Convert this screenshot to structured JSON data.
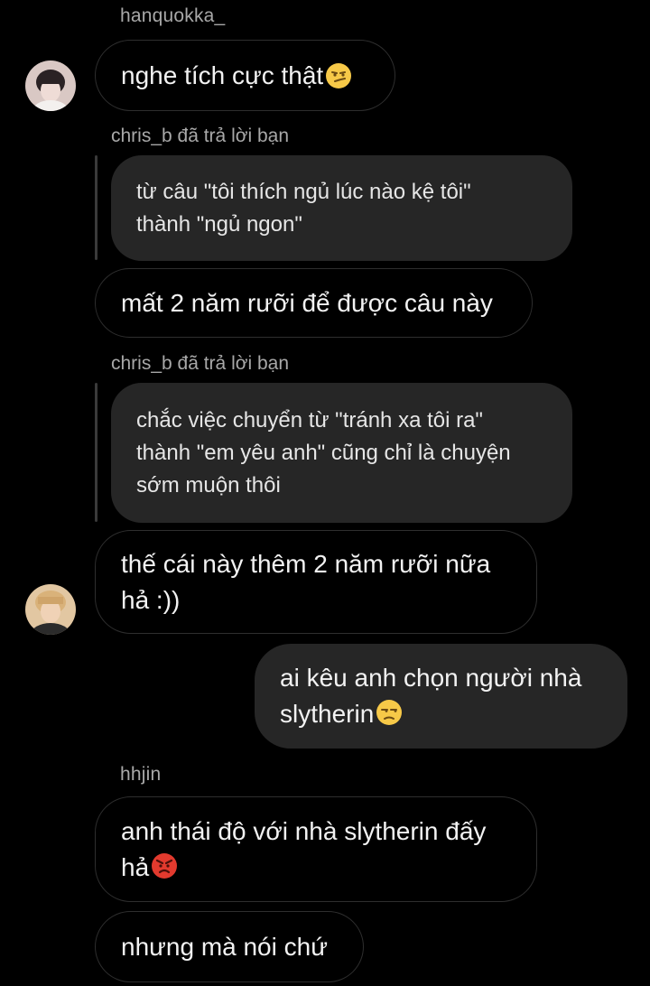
{
  "thread": {
    "group1": {
      "sender": "hanquokka_",
      "message": "nghe tích cực thật",
      "emoji": "smirk-emoji"
    },
    "reply1": {
      "caption": "chris_b đã trả lời bạn",
      "quoted_text": "từ câu \"tôi thích ngủ lúc nào kệ tôi\"\nthành \"ngủ ngon\"",
      "message": "mất 2 năm rưỡi để được câu này"
    },
    "reply2": {
      "caption": "chris_b đã trả lời bạn",
      "quoted_text": "chắc việc chuyển từ \"tránh xa tôi ra\"\nthành \"em yêu anh\" cũng chỉ là chuyện\nsớm muộn thôi",
      "message": "thế cái này thêm 2 năm rưỡi nữa\nhả :))"
    },
    "own_message": {
      "text": "ai kêu anh chọn người nhà\nslytherin",
      "emoji": "unamused-emoji"
    },
    "group2": {
      "sender": "hhjin",
      "message1": "anh thái độ với nhà slytherin đấy\nhả",
      "emoji": "angry-emoji",
      "message2": "nhưng mà nói chứ"
    }
  },
  "colors": {
    "background": "#000000",
    "incoming_border": "#2e2e2e",
    "outgoing_fill": "#262626",
    "meta_text": "#a8a8a8"
  }
}
